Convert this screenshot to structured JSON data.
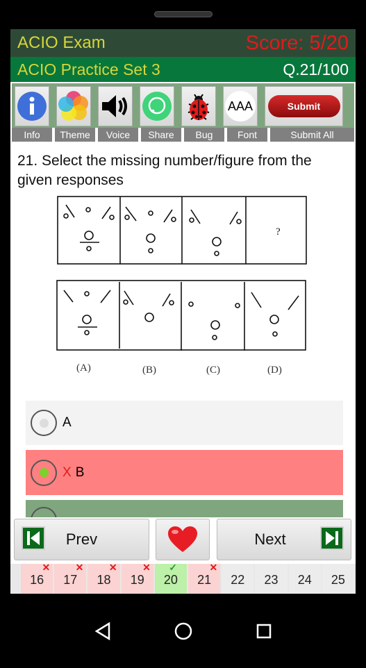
{
  "header": {
    "app_title": "ACIO Exam",
    "score": "Score: 5/20",
    "set_title": "ACIO Practice Set 3",
    "question_counter": "Q.21/100"
  },
  "toolbar": {
    "items": [
      {
        "label": "Info",
        "icon": "info-icon"
      },
      {
        "label": "Theme",
        "icon": "theme-icon"
      },
      {
        "label": "Voice",
        "icon": "speaker-icon"
      },
      {
        "label": "Share",
        "icon": "whatsapp-icon"
      },
      {
        "label": "Bug",
        "icon": "ladybug-icon"
      },
      {
        "label": "Font",
        "icon": "font-size-icon"
      },
      {
        "label": "Submit All",
        "icon": "submit-icon",
        "button_text": "Submit",
        "button_text_icon": "AAA"
      }
    ],
    "font_icon_text": "AAA"
  },
  "question": {
    "text": "21. Select the missing number/figure from the given responses",
    "figure": {
      "missing": "?",
      "answer_labels": [
        "(A)",
        "(B)",
        "(C)",
        "(D)"
      ]
    }
  },
  "options": [
    {
      "label": "A",
      "state": "unselected",
      "color": "#f3f3f3"
    },
    {
      "label": "B",
      "state": "wrong-selected",
      "mark": "X",
      "color": "#ff8080"
    },
    {
      "label": "",
      "state": "correct",
      "color": "#7fa67f"
    }
  ],
  "nav": {
    "prev": "Prev",
    "next": "Next",
    "favorite_icon": "heart-icon"
  },
  "question_numbers": [
    {
      "n": "16",
      "status": "wrong",
      "mark": "✕"
    },
    {
      "n": "17",
      "status": "wrong",
      "mark": "✕"
    },
    {
      "n": "18",
      "status": "wrong",
      "mark": "✕"
    },
    {
      "n": "19",
      "status": "wrong",
      "mark": "✕"
    },
    {
      "n": "20",
      "status": "correct",
      "mark": "✓"
    },
    {
      "n": "21",
      "status": "wrong",
      "mark": "✕"
    },
    {
      "n": "22",
      "status": "none"
    },
    {
      "n": "23",
      "status": "none"
    },
    {
      "n": "24",
      "status": "none"
    },
    {
      "n": "25",
      "status": "none"
    }
  ],
  "colors": {
    "wrong_bg": "#fbd3d3",
    "correct_bg": "#bdf0a8",
    "wrong_mark": "#e01b1b",
    "correct_mark": "#2a9a3a"
  }
}
